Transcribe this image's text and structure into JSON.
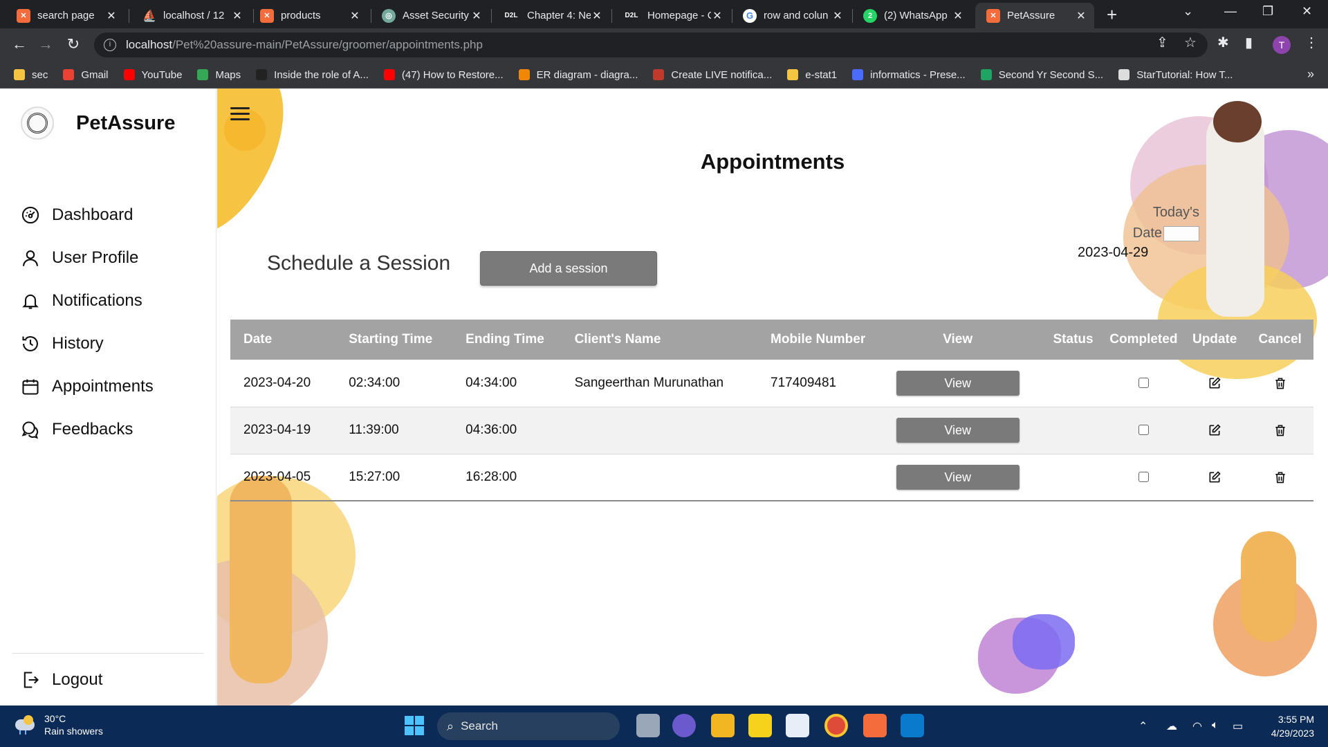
{
  "browser": {
    "tabs": [
      {
        "label": "search page",
        "icon": "xampp-icon",
        "color": "#f46c3c",
        "active": false
      },
      {
        "label": "localhost / 12",
        "icon": "phpmyadmin-icon",
        "color": "#f0a030",
        "active": false
      },
      {
        "label": "products",
        "icon": "xampp-icon",
        "color": "#f46c3c",
        "active": false
      },
      {
        "label": "Asset Security",
        "icon": "chatgpt-icon",
        "color": "#74aa9c",
        "active": false
      },
      {
        "label": "Chapter 4: Ne",
        "icon": "d2l-icon",
        "color": "#202124",
        "active": false
      },
      {
        "label": "Homepage - C",
        "icon": "d2l-icon",
        "color": "#202124",
        "active": false
      },
      {
        "label": "row and colun",
        "icon": "google-icon",
        "color": "#ffffff",
        "active": false
      },
      {
        "label": "(2) WhatsApp",
        "icon": "whatsapp-icon",
        "color": "#25d366",
        "active": false
      },
      {
        "label": "PetAssure",
        "icon": "xampp-icon",
        "color": "#f46c3c",
        "active": true
      }
    ],
    "url_host": "localhost",
    "url_path": "/Pet%20assure-main/PetAssure/groomer/appointments.php",
    "profile_initial": "T",
    "bookmarks": [
      {
        "label": "sec",
        "color": "#f5c542"
      },
      {
        "label": "Gmail",
        "color": "#ea4335"
      },
      {
        "label": "YouTube",
        "color": "#ff0000"
      },
      {
        "label": "Maps",
        "color": "#34a853"
      },
      {
        "label": "Inside the role of A...",
        "color": "#222222"
      },
      {
        "label": "(47) How to Restore...",
        "color": "#ff0000"
      },
      {
        "label": "ER diagram - diagra...",
        "color": "#f08705"
      },
      {
        "label": "Create LIVE notifica...",
        "color": "#c0392b"
      },
      {
        "label": "e-stat1",
        "color": "#f5c542"
      },
      {
        "label": "informatics - Prese...",
        "color": "#4b6bfb"
      },
      {
        "label": "Second Yr Second S...",
        "color": "#1fa463"
      },
      {
        "label": "StarTutorial: How T...",
        "color": "#dddddd"
      }
    ],
    "more_label": "»"
  },
  "sidebar": {
    "brand": "PetAssure",
    "items": [
      {
        "label": "Dashboard",
        "icon": "dashboard-gauge-icon"
      },
      {
        "label": "User Profile",
        "icon": "user-icon"
      },
      {
        "label": "Notifications",
        "icon": "bell-icon"
      },
      {
        "label": "History",
        "icon": "history-icon"
      },
      {
        "label": "Appointments",
        "icon": "calendar-icon"
      },
      {
        "label": "Feedbacks",
        "icon": "chat-bubbles-icon"
      }
    ],
    "logout": "Logout"
  },
  "main": {
    "title": "Appointments",
    "schedule_label": "Schedule a Session",
    "add_button": "Add a session",
    "today_label_1": "Today's",
    "today_label_2": "Date",
    "today_date": "2023-04-29",
    "table": {
      "headers": [
        "Date",
        "Starting Time",
        "Ending Time",
        "Client's Name",
        "Mobile Number",
        "View",
        "Status",
        "Completed",
        "Update",
        "Cancel"
      ],
      "view_label": "View",
      "rows": [
        {
          "date": "2023-04-20",
          "start": "02:34:00",
          "end": "04:34:00",
          "client": "Sangeerthan Murunathan",
          "mobile": "717409481",
          "status": "",
          "completed": false
        },
        {
          "date": "2023-04-19",
          "start": "11:39:00",
          "end": "04:36:00",
          "client": "",
          "mobile": "",
          "status": "",
          "completed": false
        },
        {
          "date": "2023-04-05",
          "start": "15:27:00",
          "end": "16:28:00",
          "client": "",
          "mobile": "",
          "status": "",
          "completed": false
        }
      ]
    }
  },
  "taskbar": {
    "temperature": "30°C",
    "weather": "Rain showers",
    "search": "Search",
    "time": "3:55 PM",
    "date": "4/29/2023"
  }
}
